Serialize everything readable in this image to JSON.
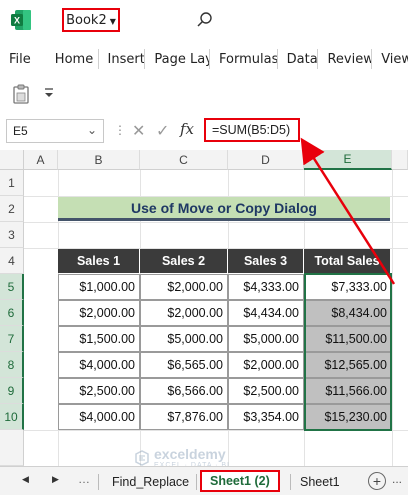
{
  "app": {
    "workbook_name": "Book2"
  },
  "menu": [
    "File",
    "Home",
    "Insert",
    "Page Layo",
    "Formulas",
    "Data",
    "Review",
    "View"
  ],
  "formula_bar": {
    "name_box": "E5",
    "fx_label": "fx",
    "formula": "=SUM(B5:D5)"
  },
  "columns": [
    "A",
    "B",
    "C",
    "D",
    "E"
  ],
  "rows": [
    "1",
    "2",
    "3",
    "4",
    "5",
    "6",
    "7",
    "8",
    "9",
    "10"
  ],
  "sheet": {
    "title": "Use of Move or Copy Dialog",
    "headers": [
      "Sales 1",
      "Sales 2",
      "Sales 3",
      "Total Sales"
    ],
    "data": [
      [
        "$1,000.00",
        "$2,000.00",
        "$4,333.00",
        "$7,333.00"
      ],
      [
        "$2,000.00",
        "$2,000.00",
        "$4,434.00",
        "$8,434.00"
      ],
      [
        "$1,500.00",
        "$5,000.00",
        "$5,000.00",
        "$11,500.00"
      ],
      [
        "$4,000.00",
        "$6,565.00",
        "$2,000.00",
        "$12,565.00"
      ],
      [
        "$2,500.00",
        "$6,566.00",
        "$2,500.00",
        "$11,566.00"
      ],
      [
        "$4,000.00",
        "$7,876.00",
        "$3,354.00",
        "$15,230.00"
      ]
    ]
  },
  "tabs": {
    "items": [
      "Find_Replace",
      "Sheet1 (2)",
      "Sheet1"
    ],
    "active": "Sheet1 (2)",
    "more": "..."
  },
  "watermark": {
    "name": "exceldemy",
    "tagline": "EXCEL · DATA · BI"
  },
  "colors": {
    "highlight_red": "#e8000b",
    "excel_green": "#217346",
    "title_fill": "#c5dfb4",
    "header_fill": "#3b3b3b",
    "total_fill": "#c0c0c0"
  }
}
